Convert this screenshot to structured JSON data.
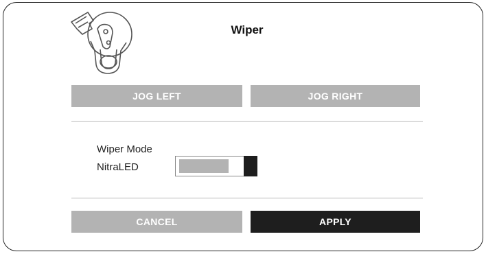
{
  "dialog": {
    "title": "Wiper",
    "device_icon": "wiper-device-icon"
  },
  "jog": {
    "left_label": "JOG LEFT",
    "right_label": "JOG RIGHT"
  },
  "wiper_mode": {
    "label": "Wiper Mode",
    "value_label": "NitraLED",
    "slider_fill_fraction": 0.82
  },
  "actions": {
    "cancel_label": "CANCEL",
    "apply_label": "APPLY"
  },
  "colors": {
    "button_gray": "#b3b3b3",
    "button_dark": "#1e1e1e",
    "border": "#222222"
  }
}
